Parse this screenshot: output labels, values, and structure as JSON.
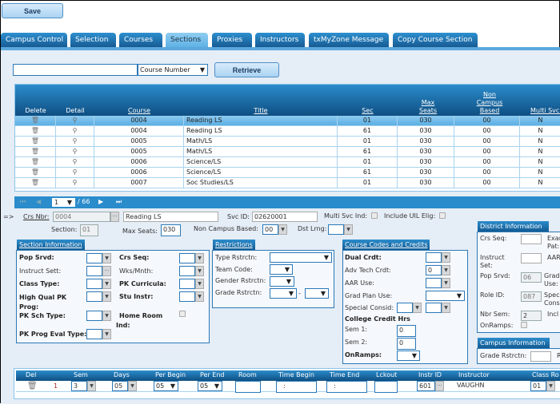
{
  "toolbar": {
    "save_label": "Save"
  },
  "tabs": [
    "Campus Control",
    "Selection",
    "Courses",
    "Sections",
    "Proxies",
    "Instructors",
    "txMyZone Message",
    "Copy Course Section"
  ],
  "active_tab": "Sections",
  "search": {
    "value": "",
    "filter": "Course Number",
    "retrieve_label": "Retrieve"
  },
  "grid": {
    "headers": {
      "delete": "Delete",
      "detail": "Detail",
      "course": "Course",
      "title": "Title",
      "sec": "Sec",
      "max_seats": "Max Seats",
      "non_campus": "Non Campus Based",
      "multi": "Multi Svc Ind"
    },
    "rows": [
      {
        "course": "0004",
        "title": "Reading LS",
        "sec": "01",
        "max": "030",
        "nc": "00",
        "multi": "N"
      },
      {
        "course": "0004",
        "title": "Reading LS",
        "sec": "61",
        "max": "030",
        "nc": "00",
        "multi": "N"
      },
      {
        "course": "0005",
        "title": "Math/LS",
        "sec": "01",
        "max": "030",
        "nc": "00",
        "multi": "N"
      },
      {
        "course": "0005",
        "title": "Math/LS",
        "sec": "61",
        "max": "030",
        "nc": "00",
        "multi": "N"
      },
      {
        "course": "0006",
        "title": "Science/LS",
        "sec": "01",
        "max": "030",
        "nc": "00",
        "multi": "N"
      },
      {
        "course": "0006",
        "title": "Science/LS",
        "sec": "61",
        "max": "030",
        "nc": "00",
        "multi": "N"
      },
      {
        "course": "0007",
        "title": "Soc Studies/LS",
        "sec": "01",
        "max": "030",
        "nc": "00",
        "multi": "N"
      }
    ]
  },
  "pager": {
    "page": "1",
    "total": "/ 66"
  },
  "detail": {
    "arrow": "=>",
    "crs_nbr_label": "Crs Nbr:",
    "crs_nbr": "0004",
    "title": "Reading LS",
    "svc_id_label": "Svc ID:",
    "svc_id": "02620001",
    "multi_svc_label": "Multi Svc Ind:",
    "uil_label": "Include UIL Elig:",
    "section_label": "Section:",
    "section": "01",
    "max_seats_label": "Max Seats:",
    "max_seats": "030",
    "ncb_label": "Non Campus Based:",
    "ncb": "00",
    "dst_lrng_label": "Dst Lrng:"
  },
  "section_info": {
    "title": "Section Information",
    "pop_srvd": "Pop Srvd:",
    "instruct_sett": "Instruct Sett:",
    "class_type": "Class Type:",
    "hq_pk": "High Qual PK Prog:",
    "pk_sch": "PK Sch Type:",
    "pk_eval": "PK Prog Eval Type:",
    "crs_seq": "Crs Seq:",
    "wks": "Wks/Mnth:",
    "pk_curr": "PK Curricula:",
    "stu_instr": "Stu Instr:",
    "home_room": "Home Room Ind:"
  },
  "restrictions": {
    "title": "Restrictions",
    "type": "Type Rstrctn:",
    "team": "Team Code:",
    "gender": "Gender Rstrctn:",
    "grade": "Grade Rstrctn:",
    "dash": "-"
  },
  "codes": {
    "title": "Course Codes and Credits",
    "dual": "Dual Crdt:",
    "adv": "Adv Tech Crdt:",
    "adv_val": "0",
    "aar": "AAR Use:",
    "grad": "Grad Plan Use:",
    "special": "Special Consid:",
    "cch": "College Credit Hrs",
    "sem1": "Sem 1:",
    "sem1_val": "0",
    "sem2": "Sem 2:",
    "sem2_val": "0",
    "onramps": "OnRamps:"
  },
  "district": {
    "title": "District Information",
    "crs_seq": "Crs Seq:",
    "exam": "Exam Pat:",
    "instruct": "Instruct Set:",
    "aar": "AAR",
    "pop": "Pop Srvd:",
    "pop_val": "06",
    "grad": "Grad Use:",
    "role": "Role ID:",
    "role_val": "087",
    "spec": "Spec Cons",
    "nbr_sem": "Nbr Sem:",
    "nbr_val": "2",
    "incl": "Incl",
    "onramps": "OnRamps:"
  },
  "campus": {
    "title": "Campus Information",
    "grade": "Grade Rstrctn:",
    "r": "R"
  },
  "schedule": {
    "headers": [
      "Del",
      "Sem",
      "Days",
      "Per Begin",
      "Per End",
      "Room",
      "Time Begin",
      "Time End",
      "Lckout",
      "Instr ID",
      "Instructor",
      "Class Ro"
    ],
    "row": {
      "num": "1",
      "sem": "3",
      "days": "05",
      "per_begin": "05",
      "per_end": "05",
      "room": "",
      "time_begin": ":",
      "time_end": ":",
      "lckout": "",
      "instr_id": "601",
      "instructor": "VAUGHN",
      "class_room": "01"
    }
  },
  "colors": {
    "accent": "#1f75b5",
    "header_dark": "#0f4f82",
    "selected_row": "#6bb8e8",
    "bg": "#e5edf6"
  }
}
